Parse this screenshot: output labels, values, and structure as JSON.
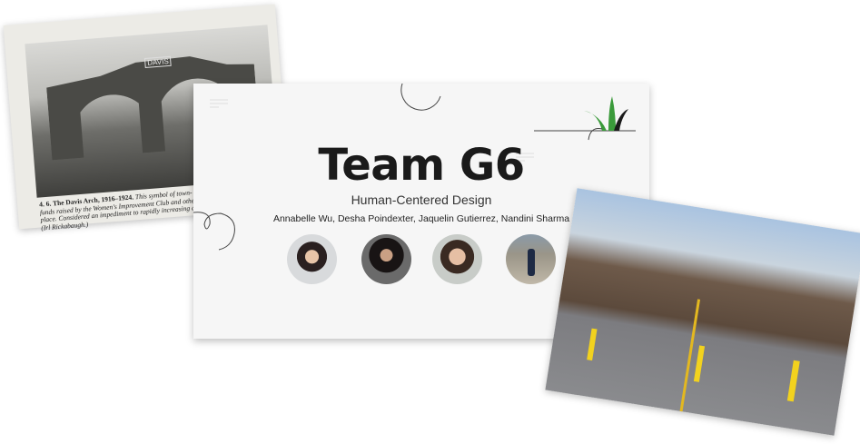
{
  "old_photo": {
    "sign_text": "DAVIS",
    "caption_bold": "4. 6. The Davis Arch, 1916–1924.",
    "caption_lines": [
      "This symbol of town-",
      "funds raised by the Women's Improvement Club and other g",
      "place. Considered an impediment to rapidly increasing autom",
      "(Irl Rickabaugh.)"
    ]
  },
  "slide": {
    "title": "Team G6",
    "subtitle": "Human-Centered Design",
    "names": "Annabelle Wu, Desha Poindexter, Jaquelin Gutierrez, Nandini Sharma",
    "accent_color": "#3a9a3a"
  }
}
